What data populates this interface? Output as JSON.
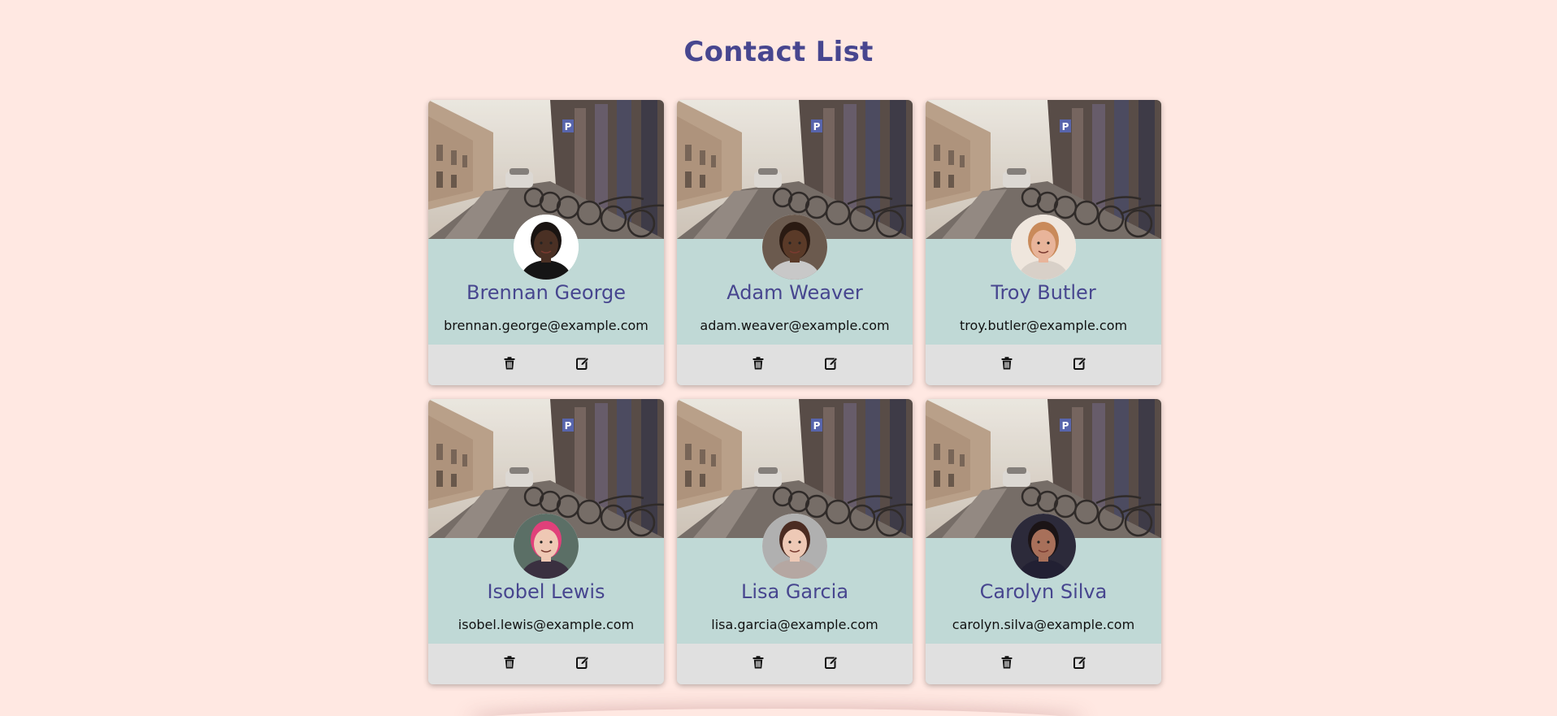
{
  "page": {
    "title": "Contact List"
  },
  "colors": {
    "background": "#ffe8e2",
    "title": "#47468f",
    "card_body": "#c0d9d6",
    "card_actions": "#e0e0e0"
  },
  "contacts": [
    {
      "name": "Brennan George",
      "email": "brennan.george@example.com",
      "avatar_icon": "avatar-photo",
      "skin": "#4a3024",
      "hair": "#1a1412",
      "shirt": "#151515",
      "bg": "#ffffff"
    },
    {
      "name": "Adam Weaver",
      "email": "adam.weaver@example.com",
      "avatar_icon": "avatar-photo",
      "skin": "#5a3a28",
      "hair": "#2a1a12",
      "shirt": "#c8c8c8",
      "bg": "#6b5a4e"
    },
    {
      "name": "Troy Butler",
      "email": "troy.butler@example.com",
      "avatar_icon": "avatar-photo",
      "skin": "#e8b49a",
      "hair": "#c98a5a",
      "shirt": "#d8d0c8",
      "bg": "#efe6dd"
    },
    {
      "name": "Isobel Lewis",
      "email": "isobel.lewis@example.com",
      "avatar_icon": "avatar-photo",
      "skin": "#efc8b4",
      "hair": "#e0407a",
      "shirt": "#3a3040",
      "bg": "#5b6f66"
    },
    {
      "name": "Lisa Garcia",
      "email": "lisa.garcia@example.com",
      "avatar_icon": "avatar-photo",
      "skin": "#eec9b6",
      "hair": "#4b2c22",
      "shirt": "#b5a7a2",
      "bg": "#b0b0b0"
    },
    {
      "name": "Carolyn Silva",
      "email": "carolyn.silva@example.com",
      "avatar_icon": "avatar-photo",
      "skin": "#a8705a",
      "hair": "#1b1416",
      "shirt": "#222033",
      "bg": "#2c2a3a"
    }
  ],
  "actions": {
    "delete_icon": "trash-icon",
    "edit_icon": "edit-icon"
  }
}
